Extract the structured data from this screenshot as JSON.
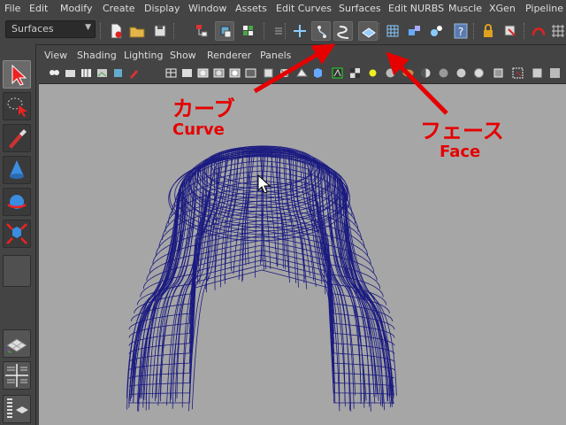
{
  "menu": [
    "File",
    "Edit",
    "Modify",
    "Create",
    "Display",
    "Window",
    "Assets",
    "Edit Curves",
    "Surfaces",
    "Edit NURBS",
    "Muscle",
    "XGen",
    "Pipeline C"
  ],
  "toolbar": {
    "menuset": "Surfaces"
  },
  "view_menu": [
    "View",
    "Shading",
    "Lighting",
    "Show",
    "Renderer",
    "Panels"
  ],
  "annotations": {
    "curve_jp": "カーブ",
    "curve_en": "Curve",
    "face_jp": "フェース",
    "face_en": "Face"
  },
  "colors": {
    "wire": "#1a1a80",
    "annotation": "#e60000",
    "viewport_bg": "#a6a6a6"
  }
}
